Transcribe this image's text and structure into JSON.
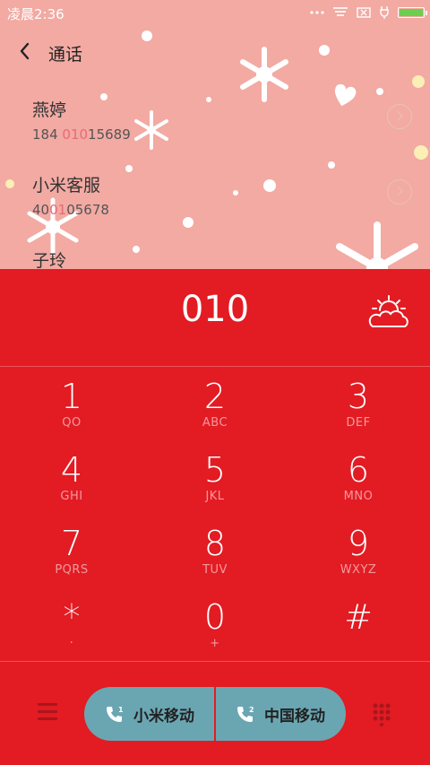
{
  "status_bar": {
    "time": "凌晨2:36"
  },
  "header": {
    "title": "通话"
  },
  "contacts": [
    {
      "name": "燕婷",
      "number_pre": "184 ",
      "number_hl": "010",
      "number_post": "15689"
    },
    {
      "name": "小米客服",
      "number_pre": "40",
      "number_hl": "01",
      "number_post": "05678"
    },
    {
      "name": "子玲",
      "number_pre": "",
      "number_hl": "",
      "number_post": ""
    }
  ],
  "dialer": {
    "input": "010",
    "keys": [
      {
        "num": "1",
        "letters": "QO"
      },
      {
        "num": "2",
        "letters": "ABC"
      },
      {
        "num": "3",
        "letters": "DEF"
      },
      {
        "num": "4",
        "letters": "GHI"
      },
      {
        "num": "5",
        "letters": "JKL"
      },
      {
        "num": "6",
        "letters": "MNO"
      },
      {
        "num": "7",
        "letters": "PQRS"
      },
      {
        "num": "8",
        "letters": "TUV"
      },
      {
        "num": "9",
        "letters": "WXYZ"
      },
      {
        "num": "*",
        "letters": "·"
      },
      {
        "num": "0",
        "letters": "+"
      },
      {
        "num": "#",
        "letters": ""
      }
    ]
  },
  "sims": [
    {
      "label": "小米移动",
      "slot": "1"
    },
    {
      "label": "中国移动",
      "slot": "2"
    }
  ],
  "colors": {
    "dialer_bg": "#e31b23",
    "top_bg": "#f2aaa3",
    "sim_button": "#6aa6b2",
    "battery": "#6ccf4e"
  },
  "battery_level": 1.0
}
